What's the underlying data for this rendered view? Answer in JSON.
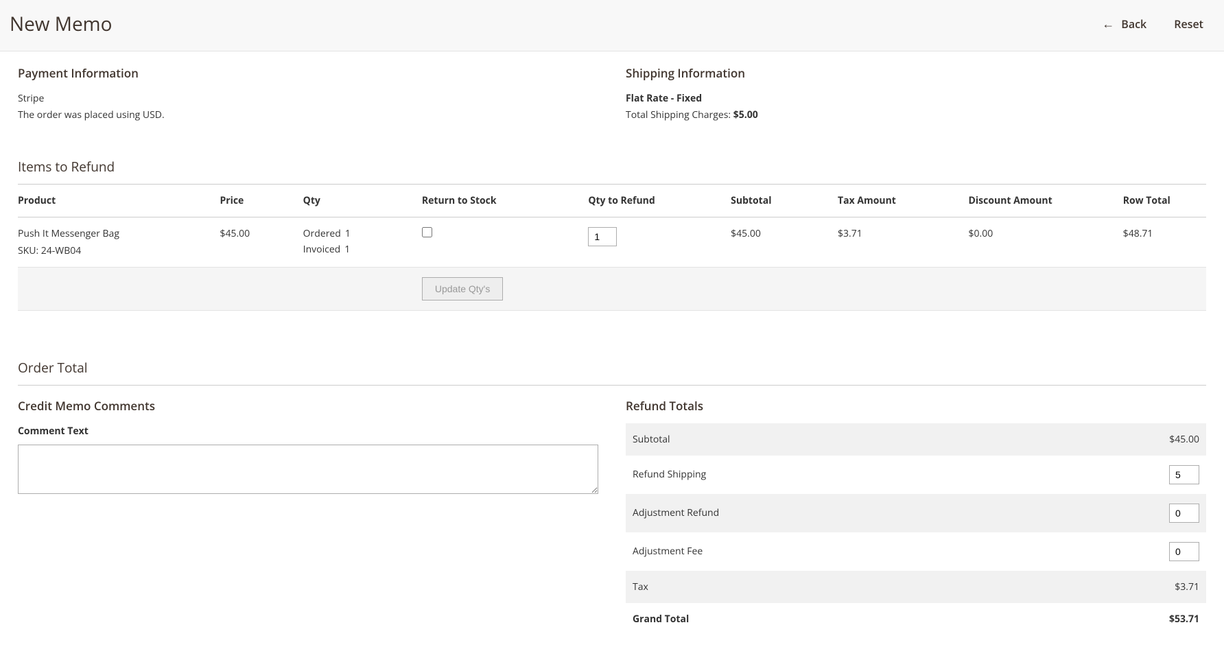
{
  "header": {
    "title": "New Memo",
    "back_label": "Back",
    "reset_label": "Reset"
  },
  "payment": {
    "title": "Payment Information",
    "method": "Stripe",
    "currency_note": "The order was placed using USD."
  },
  "shipping": {
    "title": "Shipping Information",
    "method": "Flat Rate - Fixed",
    "charges_label": "Total Shipping Charges: ",
    "charges_value": "$5.00"
  },
  "items": {
    "heading": "Items to Refund",
    "columns": {
      "product": "Product",
      "price": "Price",
      "qty": "Qty",
      "return_to_stock": "Return to Stock",
      "qty_to_refund": "Qty to Refund",
      "subtotal": "Subtotal",
      "tax_amount": "Tax Amount",
      "discount_amount": "Discount Amount",
      "row_total": "Row Total"
    },
    "rows": [
      {
        "name": "Push It Messenger Bag",
        "sku_label": "SKU: 24-WB04",
        "price": "$45.00",
        "ordered_label": "Ordered",
        "ordered_qty": "1",
        "invoiced_label": "Invoiced",
        "invoiced_qty": "1",
        "qty_to_refund": "1",
        "subtotal": "$45.00",
        "tax": "$3.71",
        "discount": "$0.00",
        "row_total": "$48.71"
      }
    ],
    "update_btn": "Update Qty's"
  },
  "order_total": {
    "heading": "Order Total",
    "comments": {
      "title": "Credit Memo Comments",
      "label": "Comment Text",
      "value": ""
    },
    "refund_totals": {
      "title": "Refund Totals",
      "subtotal_label": "Subtotal",
      "subtotal_value": "$45.00",
      "refund_shipping_label": "Refund Shipping",
      "refund_shipping_value": "5",
      "adj_refund_label": "Adjustment Refund",
      "adj_refund_value": "0",
      "adj_fee_label": "Adjustment Fee",
      "adj_fee_value": "0",
      "tax_label": "Tax",
      "tax_value": "$3.71",
      "grand_total_label": "Grand Total",
      "grand_total_value": "$53.71"
    }
  }
}
